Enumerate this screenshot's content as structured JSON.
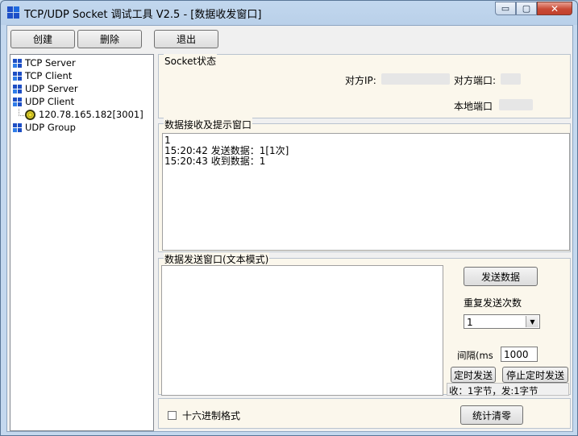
{
  "window": {
    "title": "TCP/UDP Socket 调试工具 V2.5 - [数据收发窗口]",
    "icon": "app-grid-icon",
    "caption_minimize": "▭",
    "caption_maximize": "▢",
    "caption_close": "✕"
  },
  "toolbar": {
    "create_label": "创建",
    "delete_label": "删除",
    "exit_label": "退出"
  },
  "tree": {
    "items": [
      {
        "label": "TCP Server",
        "icon": "network-node-icon"
      },
      {
        "label": "TCP Client",
        "icon": "network-node-icon"
      },
      {
        "label": "UDP Server",
        "icon": "network-node-icon"
      },
      {
        "label": "UDP Client",
        "icon": "network-node-icon"
      },
      {
        "label": "UDP Group",
        "icon": "network-node-icon"
      }
    ],
    "child": {
      "label": "120.78.165.182[3001]",
      "icon": "connection-icon"
    }
  },
  "socket_status": {
    "legend": "Socket状态",
    "peer_ip_label": "对方IP:",
    "peer_port_label": "对方端口:",
    "local_port_label": "本地端口"
  },
  "receive": {
    "legend": "数据接收及提示窗口",
    "lines": [
      "1",
      "15:20:42 发送数据：1[1次]",
      "15:20:43 收到数据：1"
    ]
  },
  "send": {
    "legend": "数据发送窗口(文本模式)",
    "send_button": "发送数据",
    "repeat_label": "重复发送次数",
    "repeat_value": "1",
    "interval_label": "间隔(ms",
    "interval_value": "1000",
    "timed_send_button": "定时发送",
    "stop_timed_button": "停止定时发送",
    "stats_text": "收：1字节，发:1字节"
  },
  "footer": {
    "hex_checkbox_label": "十六进制格式",
    "stats_clear_button": "统计清零"
  }
}
